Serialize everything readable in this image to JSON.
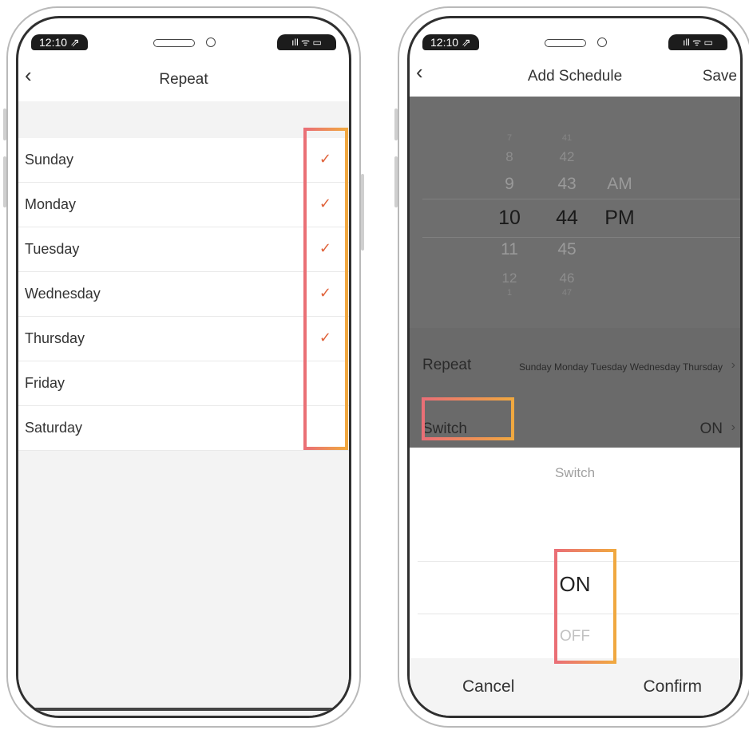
{
  "left_phone": {
    "status_time": "12:10 ⇗",
    "status_icons": "ıll ᯤ ▭",
    "title": "Repeat",
    "back_icon": "chevron-left-icon",
    "days": [
      {
        "label": "Sunday",
        "checked": true
      },
      {
        "label": "Monday",
        "checked": true
      },
      {
        "label": "Tuesday",
        "checked": true
      },
      {
        "label": "Wednesday",
        "checked": true
      },
      {
        "label": "Thursday",
        "checked": true
      },
      {
        "label": "Friday",
        "checked": false
      },
      {
        "label": "Saturday",
        "checked": false
      }
    ],
    "check_glyph": "✓"
  },
  "right_phone": {
    "status_time": "12:10 ⇗",
    "status_icons": "ıll ᯤ ▭",
    "title": "Add Schedule",
    "save_label": "Save",
    "picker": {
      "hours": [
        "7",
        "8",
        "9",
        "10",
        "11",
        "12",
        "1"
      ],
      "minutes": [
        "41",
        "42",
        "43",
        "44",
        "45",
        "46",
        "47"
      ],
      "ampm": [
        "AM",
        "PM"
      ],
      "selected_hour": "10",
      "selected_minute": "44",
      "selected_ampm": "PM"
    },
    "repeat": {
      "label": "Repeat",
      "value": "Sunday Monday Tuesday Wednesday Thursday"
    },
    "switch": {
      "label": "Switch",
      "value": "ON"
    },
    "sheet": {
      "title": "Switch",
      "options": [
        "ON",
        "OFF"
      ],
      "cancel_label": "Cancel",
      "confirm_label": "Confirm"
    },
    "chevron_glyph": "›"
  },
  "colors": {
    "check": "#e0623a",
    "highlight_start": "#ea6f76",
    "highlight_end": "#f0a840",
    "dim_overlay": "#6a6a6a"
  }
}
